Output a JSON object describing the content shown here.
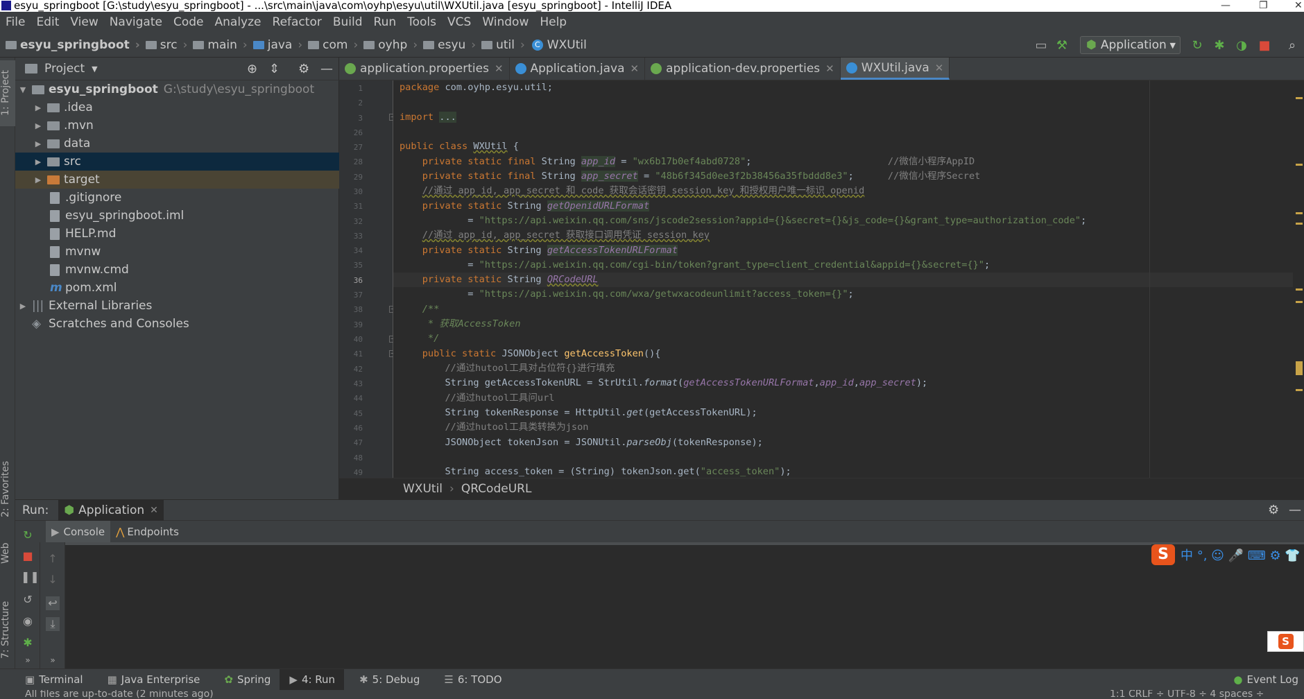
{
  "window": {
    "title": "esyu_springboot [G:\\study\\esyu_springboot] - ...\\src\\main\\java\\com\\oyhp\\esyu\\util\\WXUtil.java [esyu_springboot] - IntelliJ IDEA"
  },
  "menu": [
    "File",
    "Edit",
    "View",
    "Navigate",
    "Code",
    "Analyze",
    "Refactor",
    "Build",
    "Run",
    "Tools",
    "VCS",
    "Window",
    "Help"
  ],
  "nav": {
    "crumbs": [
      "esyu_springboot",
      "src",
      "main",
      "java",
      "com",
      "oyhp",
      "esyu",
      "util"
    ],
    "current": "WXUtil",
    "run_config": "Application"
  },
  "project": {
    "header": "Project",
    "tree": [
      {
        "label": "esyu_springboot",
        "path": "G:\\study\\esyu_springboot"
      },
      {
        "label": ".idea"
      },
      {
        "label": ".mvn"
      },
      {
        "label": "data"
      },
      {
        "label": "src"
      },
      {
        "label": "target"
      },
      {
        "label": ".gitignore"
      },
      {
        "label": "esyu_springboot.iml"
      },
      {
        "label": "HELP.md"
      },
      {
        "label": "mvnw"
      },
      {
        "label": "mvnw.cmd"
      },
      {
        "label": "pom.xml"
      },
      {
        "label": "External Libraries"
      },
      {
        "label": "Scratches and Consoles"
      }
    ]
  },
  "tabs": [
    {
      "label": "application.properties",
      "color": "#6aa84f"
    },
    {
      "label": "Application.java",
      "color": "#3a8fd6"
    },
    {
      "label": "application-dev.properties",
      "color": "#6aa84f"
    },
    {
      "label": "WXUtil.java",
      "color": "#3a8fd6"
    }
  ],
  "editor": {
    "line_numbers": [
      "1",
      "2",
      "3",
      "26",
      "27",
      "28",
      "29",
      "30",
      "31",
      "32",
      "33",
      "34",
      "35",
      "36",
      "37",
      "38",
      "39",
      "40",
      "41",
      "42",
      "43",
      "44",
      "45",
      "46",
      "47",
      "48",
      "49"
    ],
    "code": {
      "pkg_kw": "package",
      "pkg_name": " com.oyhp.esyu.util;",
      "import_kw": "import",
      "import_fold": "...",
      "l27_a": "public class ",
      "l27_b": "WXUtil",
      " l27_c": " {",
      "pri_sf": "private static final ",
      "str": "String ",
      "app_id": "app_id",
      "app_id_val": "\"wx6b17b0ef4abd0728\"",
      "app_id_cm": "//微信小程序AppID",
      "app_secret": "app_secret",
      "app_secret_val": "\"48b6f345d0ee3f2b38456a35fbddd8e3\"",
      "app_secret_cm": "//微信小程序Secret",
      "l30": "//通过 app_id, app_secret 和 code 获取会话密钥 session_key 和授权用户唯一标识 openid",
      "pri_s": "private static ",
      "openid_fmt": "getOpenidURLFormat",
      "l32_val": "\"https://api.weixin.qq.com/sns/jscode2session?appid={}&secret={}&js_code={}&grant_type=authorization_code\"",
      "l33": "//通过 app_id, app_secret 获取接口调用凭证 session_key",
      "token_fmt": "getAccessTokenURLFormat",
      "l35_val": "\"https://api.weixin.qq.com/cgi-bin/token?grant_type=client_credential&appid={}&secret={}\"",
      "qrcode": "QRCodeURL",
      "l37_val": "\"https://api.weixin.qq.com/wxa/getwxacodeunlimit?access_token={}\"",
      "l38": "/**",
      "l39_a": " * 获取",
      "l39_b": "AccessToken",
      "l40": " */",
      "l41_a": "public static ",
      "l41_b": "JSONObject ",
      "l41_c": "getAccessToken",
      "l41_d": "(){",
      "l42": "//通过hutool工具对占位符{}进行填充",
      "l43_a": "String getAccessTokenURL = StrUtil.",
      "l43_b": "format",
      "l43_c": "(",
      "l43_d": "getAccessTokenURLFormat",
      "l43_e": ",",
      "l43_f": "app_id",
      "l43_g": ",",
      "l43_h": "app_secret",
      "l43_i": ");",
      "l44": "//通过hutool工具问url",
      "l45_a": "String tokenResponse = HttpUtil.",
      "l45_b": "get",
      "l45_c": "(getAccessTokenURL);",
      "l46": "//通过hutool工具类转换为json",
      "l47_a": "JSONObject tokenJson = JSONUtil.",
      "l47_b": "parseObj",
      "l47_c": "(tokenResponse);",
      "l49_a": "String access_token = (String) tokenJson.get(",
      "l49_b": "\"access_token\"",
      "l49_c": ");",
      "eq": " = "
    },
    "breadcrumb": [
      "WXUtil",
      "QRCodeURL"
    ]
  },
  "run": {
    "label": "Run:",
    "config": "Application",
    "tabs": [
      "Console",
      "Endpoints"
    ]
  },
  "sidebar_labels": {
    "project": "1: Project",
    "favorites": "2: Favorites",
    "web": "Web",
    "structure": "7: Structure"
  },
  "bottom_tabs": [
    {
      "label": "Terminal",
      "icon": "▣"
    },
    {
      "label": "Java Enterprise",
      "icon": "▦"
    },
    {
      "label": "Spring",
      "icon": "✿"
    },
    {
      "label": "4: Run",
      "icon": "▶"
    },
    {
      "label": "5: Debug",
      "icon": "✱"
    },
    {
      "label": "6: TODO",
      "icon": "☰"
    }
  ],
  "event_log": "Event Log",
  "status": {
    "left": "All files are up-to-date (2 minutes ago)",
    "right": "1:1   CRLF ÷   UTF-8 ÷   4 spaces ÷"
  },
  "ime": {
    "logo": "S",
    "chars": "中 °, ☺ 🎤 ⌨ ⚙ 👕"
  }
}
